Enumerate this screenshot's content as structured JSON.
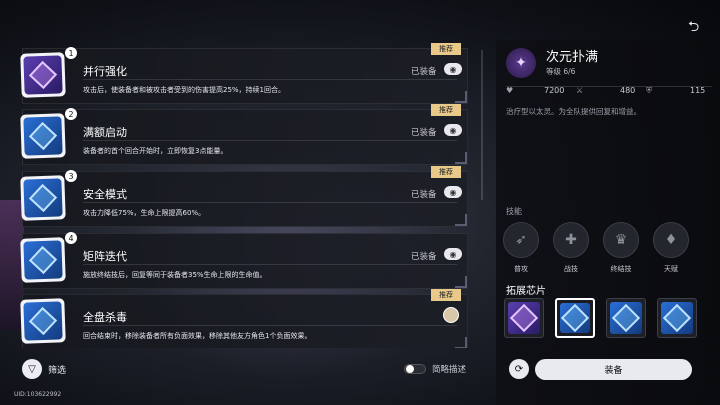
{
  "chips": [
    {
      "number": "1",
      "name": "并行强化",
      "status": "已装备",
      "badge": "推荐",
      "description": "攻击后，使装备者和被攻击者受到的伤害提高25%，持续1回合。",
      "color": "purple",
      "equip_marker": "eye-icon"
    },
    {
      "number": "2",
      "name": "满额启动",
      "status": "已装备",
      "badge": "推荐",
      "description": "装备者的首个回合开始时，立即恢复3点能量。",
      "color": "blue",
      "equip_marker": "eye-icon"
    },
    {
      "number": "3",
      "name": "安全模式",
      "status": "已装备",
      "badge": "推荐",
      "description": "攻击力降低75%，生命上限提高60%。",
      "color": "blue",
      "equip_marker": "eye-icon"
    },
    {
      "number": "4",
      "name": "矩阵迭代",
      "status": "已装备",
      "badge": "",
      "description": "施放终结技后，回复等同于装备者35%生命上限的生命值。",
      "color": "blue",
      "equip_marker": "eye-icon"
    },
    {
      "number": "",
      "name": "全盘杀毒",
      "status": "",
      "badge": "推荐",
      "description": "回合结束时，移除装备者所有负面效果，移除其他友方角色1个负面效果。",
      "color": "blue",
      "equip_marker": "avatar"
    }
  ],
  "footer": {
    "filter_label": "筛选",
    "brief_label": "简略描述",
    "uid": "UID:103622992"
  },
  "role": {
    "name": "次元扑满",
    "level": "等级 6/6",
    "stats": {
      "hp": "7200",
      "attack": "480",
      "defense": "115"
    },
    "description": "治疗型以太灵。为全队提供回复和增益。"
  },
  "skills": {
    "label": "技能",
    "items": [
      {
        "label": "普攻",
        "icon": "normal-attack-icon"
      },
      {
        "label": "战技",
        "icon": "skill-icon"
      },
      {
        "label": "终结技",
        "icon": "ultimate-icon"
      },
      {
        "label": "天赋",
        "icon": "talent-icon"
      }
    ]
  },
  "expansion": {
    "label": "拓展芯片",
    "selected_slot": 1
  },
  "actions": {
    "equip_label": "装备"
  }
}
